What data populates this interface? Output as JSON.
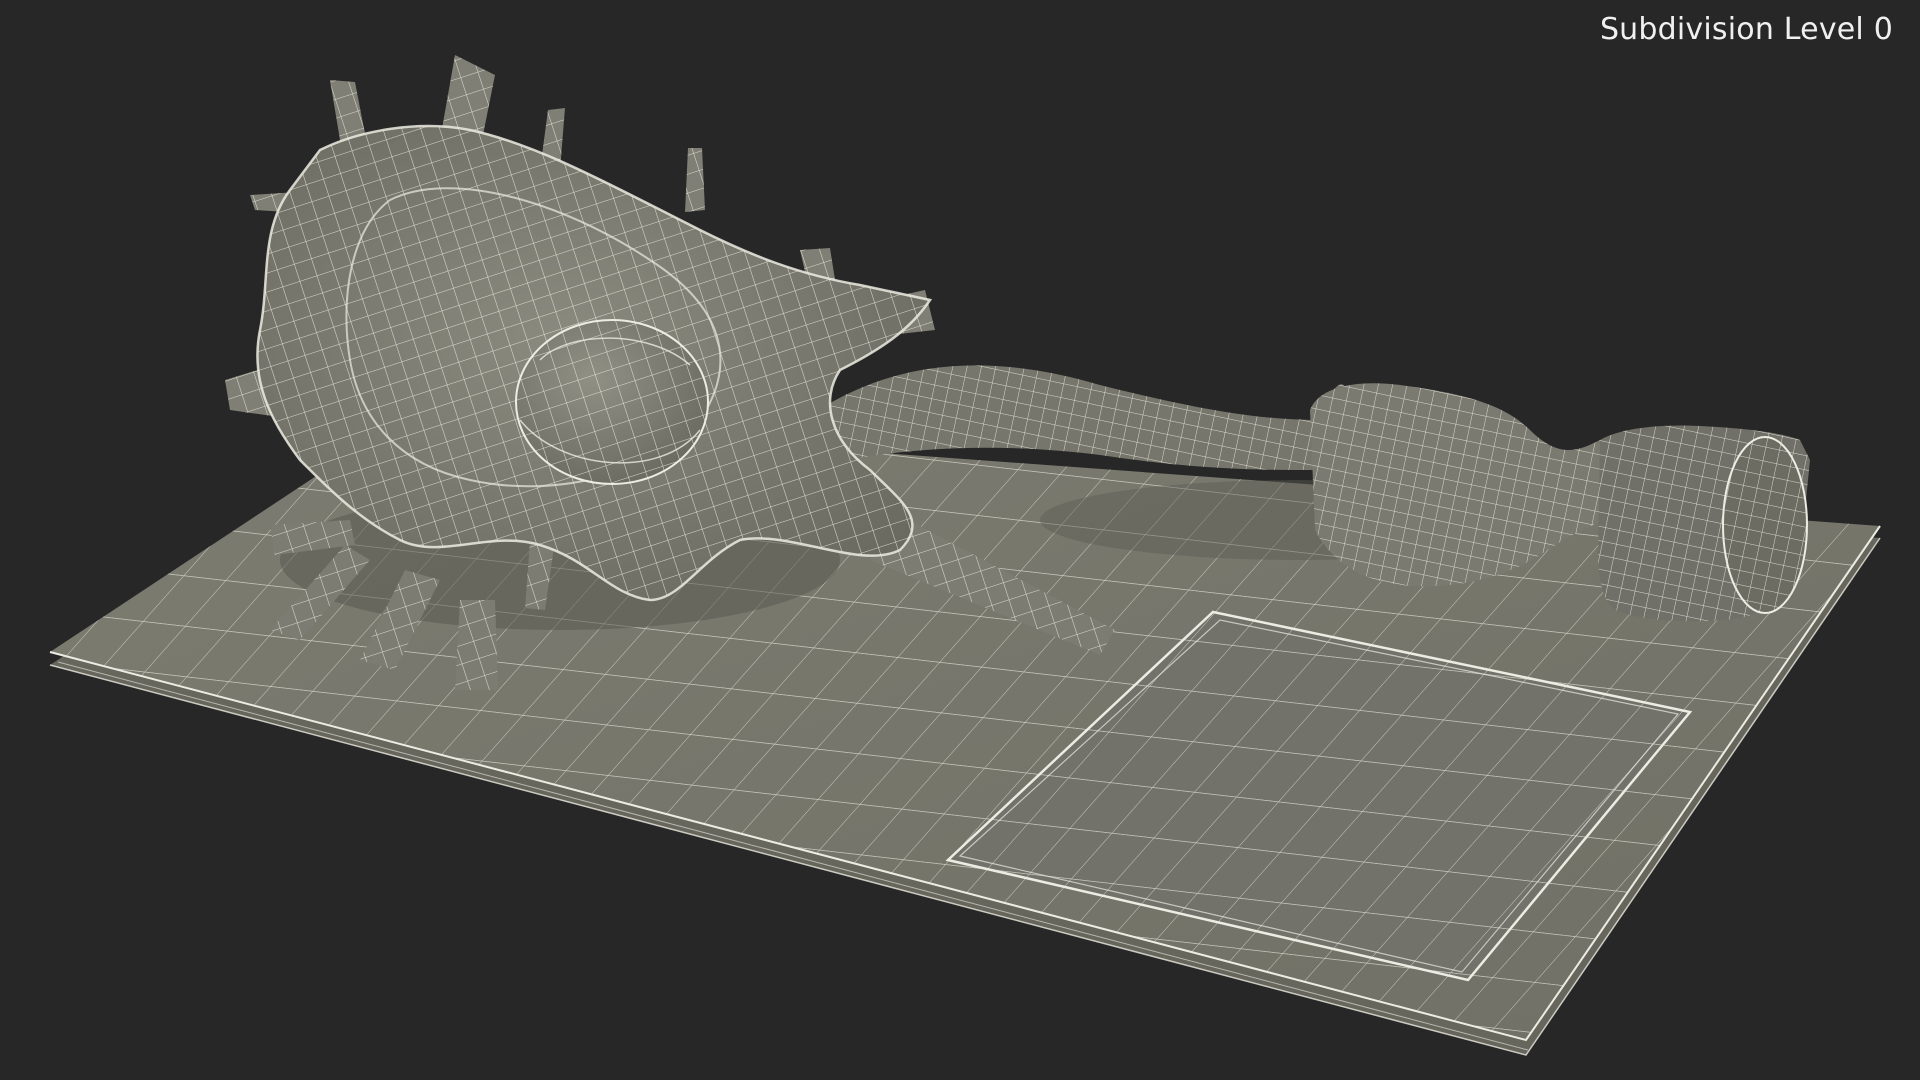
{
  "viewport": {
    "overlay_label": "Subdivision Level 0",
    "background_color": "#272727",
    "surface_color": "#77776c",
    "surface_shadow_color": "#55554d",
    "wire_color": "#ecece2"
  },
  "scene": {
    "subject": "neuron-model-wireframe",
    "parts": [
      "base-plate",
      "base-recess-panel",
      "cell-body",
      "nucleus",
      "dendrites",
      "axon",
      "axon-terminal"
    ]
  }
}
